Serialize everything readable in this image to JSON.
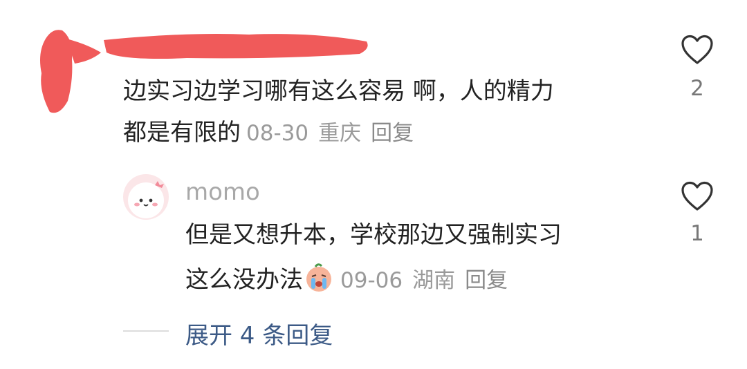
{
  "comment": {
    "text_line1": "边实习边学习哪有这么容易 啊，人的精力",
    "text_line2": "都是有限的",
    "date": "08-30",
    "location": "重庆",
    "reply_label": "回复",
    "likes": "2"
  },
  "reply": {
    "username": "momo",
    "text_line1": "但是又想升本，学校那边又强制实习",
    "text_line2": "这么没办法",
    "date": "09-06",
    "location": "湖南",
    "reply_label": "回复",
    "likes": "1"
  },
  "expand_label": "展开 4 条回复",
  "colors": {
    "redaction": "#f05a5a",
    "link": "#3c5a86",
    "meta": "#9a9a9a"
  },
  "icons": [
    "heart-outline-icon",
    "crying-emoji"
  ]
}
